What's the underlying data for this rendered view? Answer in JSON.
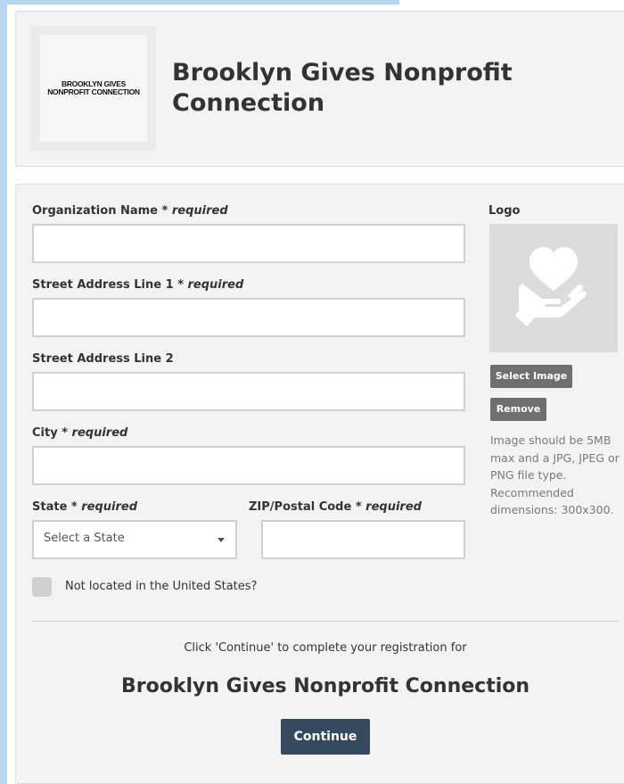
{
  "header": {
    "logo_text": "BROOKLYN GIVES NONPROFIT CONNECTION",
    "org_title": "Brooklyn Gives Nonprofit Connection"
  },
  "form": {
    "required_marker": "* required",
    "org_name_label": "Organization Name",
    "street1_label": "Street Address Line 1",
    "street2_label": "Street Address Line 2",
    "city_label": "City",
    "state_label": "State",
    "state_selected": "Select a State",
    "zip_label": "ZIP/Postal Code",
    "not_us_label": "Not located in the United States?",
    "not_us_checked": false
  },
  "logo_section": {
    "label": "Logo",
    "placeholder_icon": "heart-hand-icon",
    "select_label": "Select Image",
    "remove_label": "Remove",
    "note": "Image should be 5MB max and a JPG, JPEG or PNG file type. Recommended dimensions: 300x300."
  },
  "footer": {
    "note": "Click 'Continue' to complete your registration for",
    "title": "Brooklyn Gives Nonprofit Connection",
    "continue_label": "Continue"
  },
  "colors": {
    "accent_strip": "#b9d7ee",
    "button_primary": "#354a5f",
    "button_secondary": "#6f6f6f"
  }
}
